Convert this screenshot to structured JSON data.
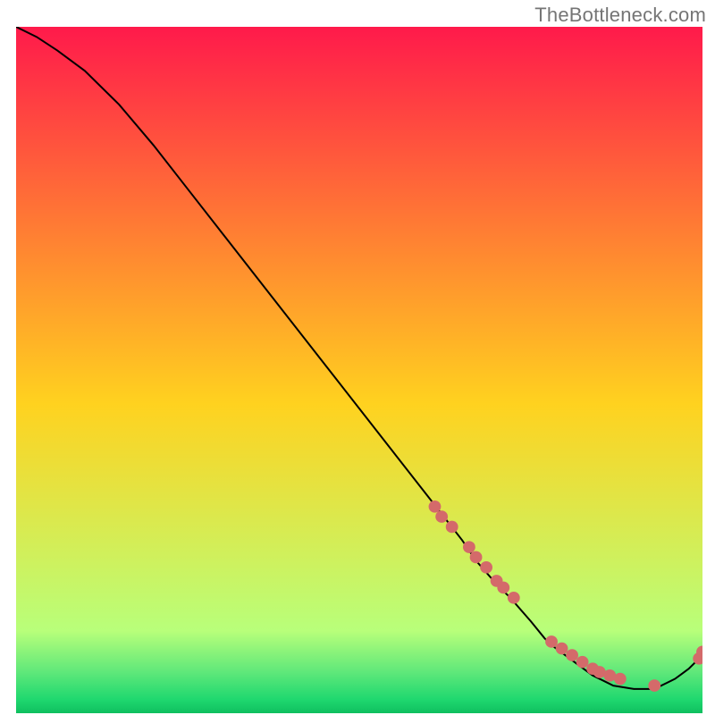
{
  "watermark": "TheBottleneck.com",
  "colors": {
    "text": "#757575",
    "line": "#000000",
    "marker": "#d46a6a",
    "grad_top": "#ff1a4b",
    "grad_mid": "#ffd21f",
    "grad_green_light": "#b8ff7a",
    "grad_green_mid": "#5fe87a",
    "grad_green_deep": "#1fd86f",
    "grad_bottom": "#0fbf5f"
  },
  "chart_data": {
    "type": "line",
    "title": "",
    "xlabel": "",
    "ylabel": "",
    "note": "Axes are unlabeled; values are normalized 0–100 read from relative position inside the plot rectangle (0 = left/bottom, 100 = right/top). Curve descends from top-left then rises near the right edge.",
    "xlim": [
      0,
      100
    ],
    "ylim": [
      0,
      100
    ],
    "series": [
      {
        "name": "curve",
        "x": [
          0,
          3,
          6,
          10,
          15,
          20,
          25,
          30,
          35,
          40,
          45,
          50,
          55,
          60,
          65,
          67,
          70,
          72,
          75,
          77,
          78,
          80,
          82,
          84,
          86,
          87,
          90,
          93,
          96,
          98,
          100
        ],
        "y": [
          100,
          98.5,
          96.5,
          93.5,
          88.5,
          82.5,
          76,
          69.5,
          63,
          56.5,
          50,
          43.5,
          37,
          30.5,
          24,
          21,
          17.5,
          15.5,
          12,
          9.5,
          8.5,
          7,
          5.5,
          4,
          3,
          2.5,
          2,
          2,
          3.5,
          5,
          7
        ]
      }
    ],
    "markers": {
      "name": "dots",
      "note": "Coral data points clustered along the lower segment of the curve.",
      "x": [
        61,
        62,
        63.5,
        66,
        67,
        68.5,
        70,
        71,
        72.5,
        78,
        79.5,
        81,
        82.5,
        84,
        85,
        86.5,
        88,
        93,
        99.5,
        100
      ],
      "y": [
        29,
        27.5,
        26,
        23,
        21.5,
        20,
        18,
        17,
        15.5,
        9,
        8,
        7,
        6,
        5,
        4.5,
        4,
        3.5,
        2.5,
        6.5,
        7.5
      ]
    }
  }
}
